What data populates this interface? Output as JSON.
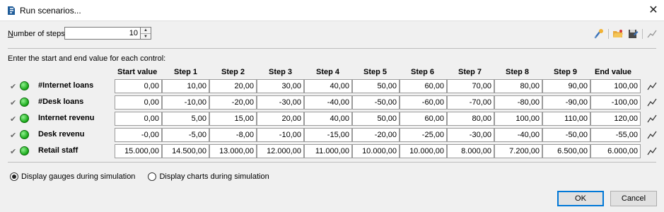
{
  "window": {
    "title": "Run scenarios...",
    "close_glyph": "✕",
    "icon": "app-logo-icon"
  },
  "steps": {
    "label_underlined": "N",
    "label_rest": "umber of steps:",
    "value": "10"
  },
  "toolbar": {
    "icons": [
      "scenario-wizard-icon",
      "open-folder-icon",
      "save-icon",
      "chart-icon"
    ]
  },
  "intro_text": "Enter the start and end value for each control:",
  "table": {
    "headers": [
      "Start value",
      "Step 1",
      "Step 2",
      "Step 3",
      "Step 4",
      "Step 5",
      "Step 6",
      "Step 7",
      "Step 8",
      "Step 9",
      "End value"
    ],
    "rows": [
      {
        "name": "#Internet loans",
        "values": [
          "0,00",
          "10,00",
          "20,00",
          "30,00",
          "40,00",
          "50,00",
          "60,00",
          "70,00",
          "80,00",
          "90,00",
          "100,00"
        ]
      },
      {
        "name": "#Desk loans",
        "values": [
          "0,00",
          "-10,00",
          "-20,00",
          "-30,00",
          "-40,00",
          "-50,00",
          "-60,00",
          "-70,00",
          "-80,00",
          "-90,00",
          "-100,00"
        ]
      },
      {
        "name": "Internet revenu",
        "values": [
          "0,00",
          "5,00",
          "15,00",
          "20,00",
          "40,00",
          "50,00",
          "60,00",
          "80,00",
          "100,00",
          "110,00",
          "120,00"
        ]
      },
      {
        "name": "Desk revenu",
        "values": [
          "-0,00",
          "-5,00",
          "-8,00",
          "-10,00",
          "-15,00",
          "-20,00",
          "-25,00",
          "-30,00",
          "-40,00",
          "-50,00",
          "-55,00"
        ]
      },
      {
        "name": "Retail staff",
        "values": [
          "15.000,00",
          "14.500,00",
          "13.000,00",
          "12.000,00",
          "11.000,00",
          "10.000,00",
          "10.000,00",
          "8.000,00",
          "7.200,00",
          "6.500,00",
          "6.000,00"
        ]
      }
    ]
  },
  "display": {
    "gauges_label": "Display gauges during simulation",
    "charts_label": "Display charts during simulation",
    "selected": "gauges"
  },
  "buttons": {
    "ok": "OK",
    "cancel": "Cancel"
  },
  "colors": {
    "status_green": "#17a817",
    "accent": "#0078d7"
  }
}
